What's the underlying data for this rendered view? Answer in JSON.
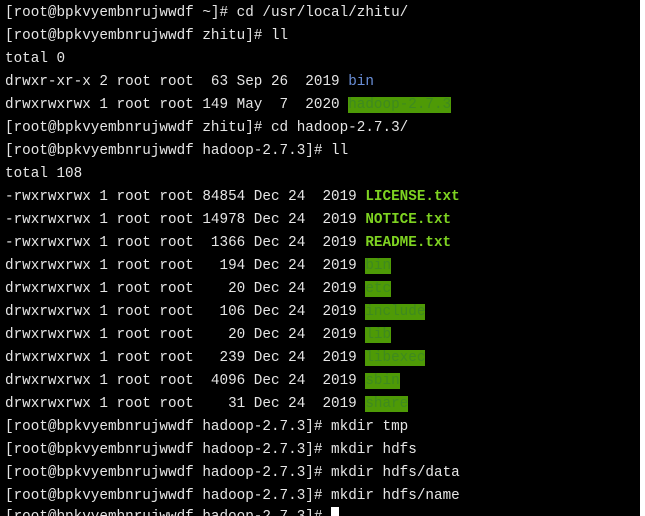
{
  "terminal": {
    "prompt_home": "[root@bpkvyembnrujwwdf ~]# ",
    "prompt_zhitu": "[root@bpkvyembnrujwwdf zhitu]# ",
    "prompt_hadoop": "[root@bpkvyembnrujwwdf hadoop-2.7.3]# ",
    "cmd_cd_zhitu": "cd /usr/local/zhitu/",
    "cmd_ll": "ll",
    "total_0": "total 0",
    "bin_meta": "drwxr-xr-x 2 root root  63 Sep 26  2019 ",
    "bin_name": "bin",
    "hadoop_meta": "drwxrwxrwx 1 root root 149 May  7  2020 ",
    "hadoop_name": "hadoop-2.7.3",
    "cmd_cd_hadoop": "cd hadoop-2.7.3/",
    "total_108": "total 108",
    "files": [
      {
        "meta": "-rwxrwxrwx 1 root root 84854 Dec 24  2019 ",
        "name": "LICENSE.txt"
      },
      {
        "meta": "-rwxrwxrwx 1 root root 14978 Dec 24  2019 ",
        "name": "NOTICE.txt"
      },
      {
        "meta": "-rwxrwxrwx 1 root root  1366 Dec 24  2019 ",
        "name": "README.txt"
      }
    ],
    "dirs": [
      {
        "meta": "drwxrwxrwx 1 root root   194 Dec 24  2019 ",
        "name": "bin"
      },
      {
        "meta": "drwxrwxrwx 1 root root    20 Dec 24  2019 ",
        "name": "etc"
      },
      {
        "meta": "drwxrwxrwx 1 root root   106 Dec 24  2019 ",
        "name": "include"
      },
      {
        "meta": "drwxrwxrwx 1 root root    20 Dec 24  2019 ",
        "name": "lib"
      },
      {
        "meta": "drwxrwxrwx 1 root root   239 Dec 24  2019 ",
        "name": "libexec"
      },
      {
        "meta": "drwxrwxrwx 1 root root  4096 Dec 24  2019 ",
        "name": "sbin"
      },
      {
        "meta": "drwxrwxrwx 1 root root    31 Dec 24  2019 ",
        "name": "share"
      }
    ],
    "cmd_mkdir_tmp": "mkdir tmp",
    "cmd_mkdir_hdfs": "mkdir hdfs",
    "cmd_mkdir_data": "mkdir hdfs/data",
    "cmd_mkdir_name": "mkdir hdfs/name",
    "colors": {
      "background": "#000000",
      "text": "#e6e6e6",
      "executable": "#7ed321",
      "dir_blue": "#6a8fd8",
      "dir_highlight": "#4e9a06"
    }
  }
}
